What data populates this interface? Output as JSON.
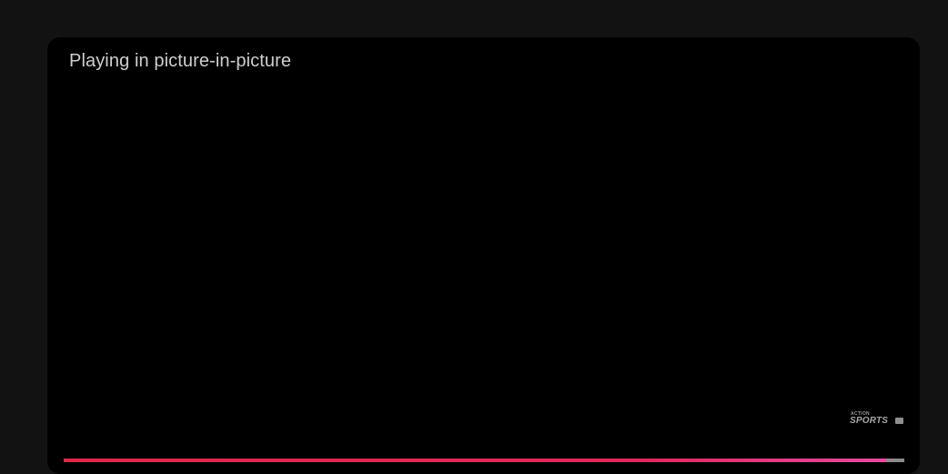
{
  "player": {
    "pip_message": "Playing in picture-in-picture",
    "watermark": {
      "top_text": "ACTION",
      "main_text": "SPORTS"
    },
    "progress": {
      "played_fraction": 0.978,
      "fill_color": "#e0274a",
      "track_color": "#8a8a8a"
    }
  }
}
